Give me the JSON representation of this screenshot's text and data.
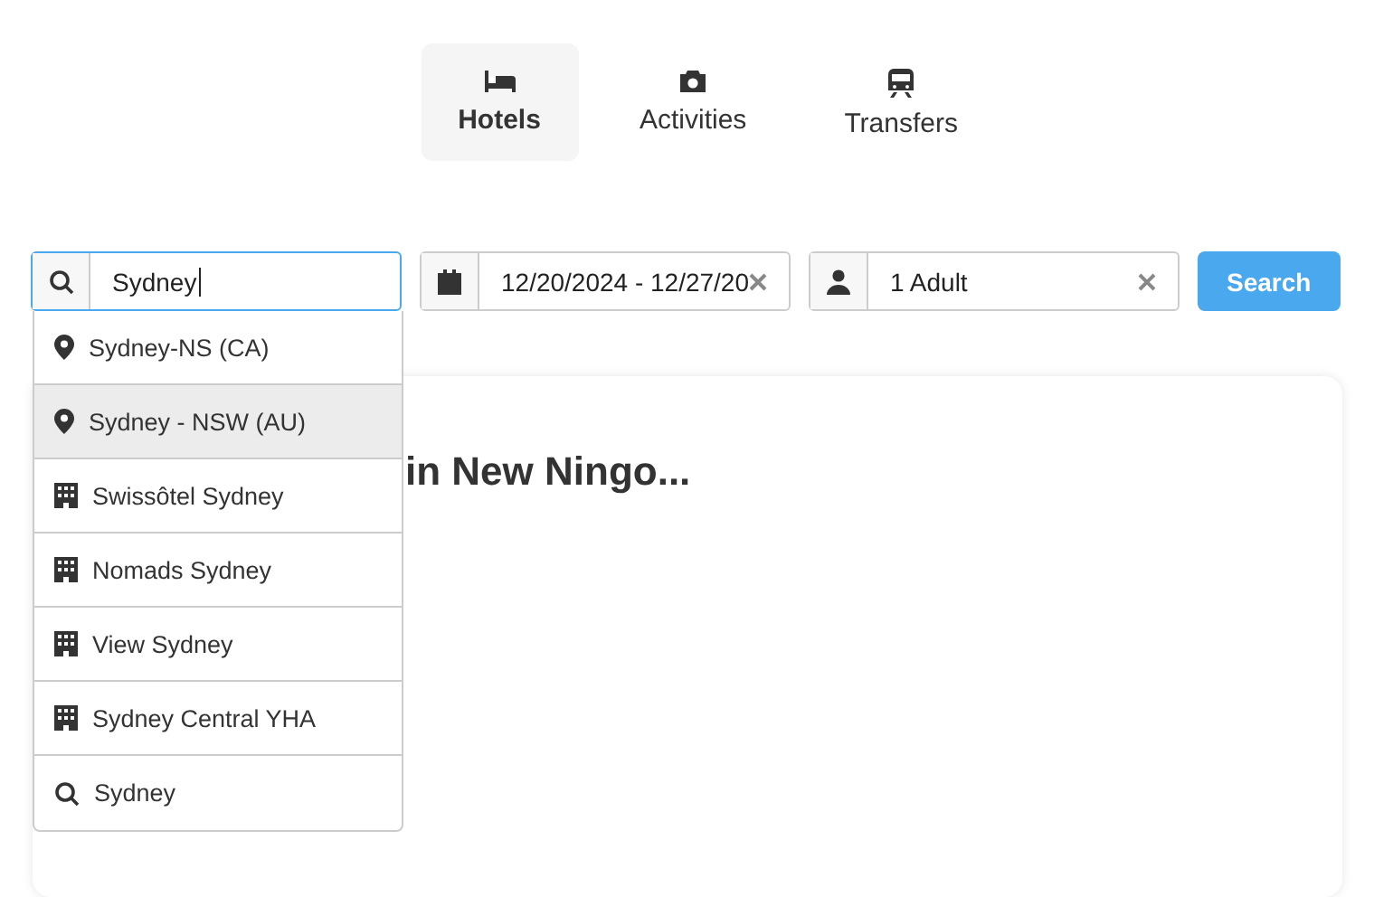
{
  "tabs": [
    {
      "label": "Hotels",
      "selected": true
    },
    {
      "label": "Activities",
      "selected": false
    },
    {
      "label": "Transfers",
      "selected": false
    }
  ],
  "search_form": {
    "destination": {
      "value": "Sydney"
    },
    "dates": {
      "value": "12/20/2024 - 12/27/20"
    },
    "guests": {
      "value": "1 Adult"
    },
    "submit": "Search"
  },
  "suggestions": [
    {
      "kind": "place",
      "label": "Sydney-NS (CA)",
      "selected": false
    },
    {
      "kind": "place",
      "label": "Sydney - NSW (AU)",
      "selected": true
    },
    {
      "kind": "hotel",
      "label": "Swissôtel Sydney",
      "selected": false
    },
    {
      "kind": "hotel",
      "label": "Nomads Sydney",
      "selected": false
    },
    {
      "kind": "hotel",
      "label": "View Sydney",
      "selected": false
    },
    {
      "kind": "hotel",
      "label": "Sydney Central YHA",
      "selected": false
    },
    {
      "kind": "search",
      "label": "Sydney",
      "selected": false
    }
  ],
  "results_card": {
    "heading": "in New Ningo..."
  }
}
